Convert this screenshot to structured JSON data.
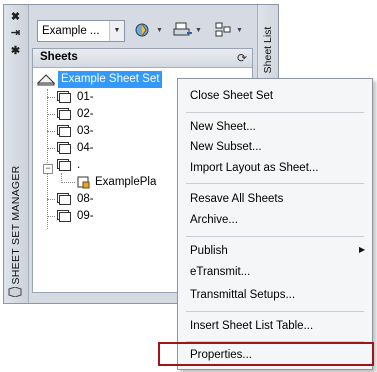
{
  "palette": {
    "title": "SHEET SET MANAGER",
    "right_tab": "Sheet List",
    "combo_value": "Example ..."
  },
  "sheets": {
    "header": "Sheets",
    "root": "Example Sheet Set",
    "items": [
      "01-",
      "02-",
      "03-",
      "04-",
      ".",
      "ExamplePla",
      "08-",
      "09-"
    ]
  },
  "menu": {
    "items": [
      "Close Sheet Set",
      "New Sheet...",
      "New Subset...",
      "Import Layout as Sheet...",
      "Resave All Sheets",
      "Archive...",
      "Publish",
      "eTransmit...",
      "Transmittal Setups...",
      "Insert Sheet List Table...",
      "Properties..."
    ]
  },
  "colors": {
    "selection": "#3399ff",
    "highlight_border": "#a0141c",
    "palette_bg": "#d6dbe3"
  }
}
